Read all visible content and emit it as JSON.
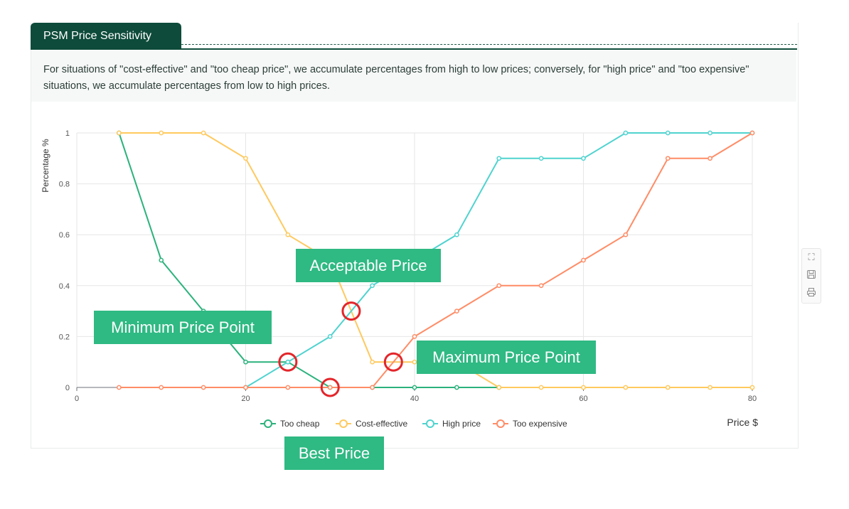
{
  "tab": {
    "title": "PSM Price Sensitivity"
  },
  "description": "For situations of \"cost-effective\" and \"too cheap price\", we accumulate percentages from high to low prices; conversely, for \"high price\" and \"too expensive\" situations, we accumulate percentages from low to high prices.",
  "chart_data": {
    "type": "line",
    "ylabel": "Percentage %",
    "xlabel": "Price $",
    "xlim": [
      0,
      80
    ],
    "ylim": [
      0,
      1
    ],
    "x_ticks": [
      "0",
      "20",
      "40",
      "60",
      "80"
    ],
    "y_ticks": [
      "0",
      "0.2",
      "0.4",
      "0.6",
      "0.8",
      "1"
    ],
    "grid": true,
    "legend_position": "bottom",
    "x": [
      5,
      10,
      15,
      20,
      25,
      30,
      35,
      40,
      45,
      50,
      55,
      60,
      65,
      70,
      75,
      80
    ],
    "series": [
      {
        "name": "Too cheap",
        "color": "#2bb27c",
        "values": [
          1,
          0.5,
          0.3,
          0.1,
          0.1,
          0,
          0,
          0,
          0,
          0,
          null,
          null,
          null,
          null,
          null,
          null
        ]
      },
      {
        "name": "Cost-effective",
        "color": "#ffc95e",
        "values": [
          1,
          1,
          1,
          0.9,
          0.6,
          0.5,
          0.1,
          0.1,
          0.1,
          0,
          0,
          0,
          0,
          0,
          0,
          0
        ]
      },
      {
        "name": "High price",
        "color": "#4fd3cf",
        "values": [
          null,
          null,
          null,
          0,
          0.1,
          0.2,
          0.4,
          0.5,
          0.6,
          0.9,
          0.9,
          0.9,
          1,
          1,
          1,
          1
        ]
      },
      {
        "name": "Too expensive",
        "color": "#ff8c66",
        "values": [
          0,
          0,
          0,
          0,
          0,
          0,
          0,
          0.2,
          0.3,
          0.4,
          0.4,
          0.5,
          0.6,
          0.9,
          0.9,
          1
        ]
      }
    ],
    "annotations": [
      {
        "label": "Acceptable Price",
        "x": 32.5,
        "y": 0.3
      },
      {
        "label": "Minimum Price Point",
        "x": 25,
        "y": 0.1
      },
      {
        "label": "Maximum Price Point",
        "x": 37.5,
        "y": 0.1
      },
      {
        "label": "Best Price",
        "x": 30,
        "y": 0
      }
    ]
  },
  "toolbox": [
    "fullscreen-icon",
    "save-icon",
    "print-icon"
  ]
}
